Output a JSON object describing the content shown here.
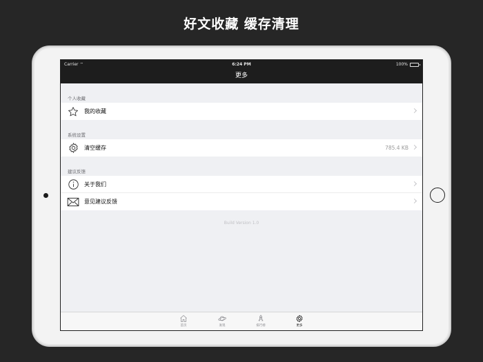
{
  "headline": "好文收藏 缓存清理",
  "status_bar": {
    "carrier": "Carrier",
    "time": "6:24 PM",
    "battery": "100%"
  },
  "nav": {
    "title": "更多"
  },
  "sections": [
    {
      "header": "个人收藏",
      "items": [
        {
          "label": "我的收藏",
          "icon": "star-icon"
        }
      ]
    },
    {
      "header": "系统设置",
      "items": [
        {
          "label": "清空缓存",
          "detail": "785.4 KB",
          "icon": "gear-icon"
        }
      ]
    },
    {
      "header": "建议反馈",
      "items": [
        {
          "label": "关于我们",
          "icon": "info-icon"
        },
        {
          "label": "意见建议反馈",
          "icon": "mail-icon"
        }
      ]
    }
  ],
  "build_version": "Build Version 1.0",
  "tabs": [
    {
      "label": "首页",
      "icon": "home-icon",
      "active": false
    },
    {
      "label": "发现",
      "icon": "planet-icon",
      "active": false
    },
    {
      "label": "排行榜",
      "icon": "rocket-icon",
      "active": false
    },
    {
      "label": "更多",
      "icon": "gear-icon",
      "active": true
    }
  ],
  "colors": {
    "background": "#262626",
    "navbar": "#1d1d1d",
    "screen_bg": "#eff0f3"
  }
}
